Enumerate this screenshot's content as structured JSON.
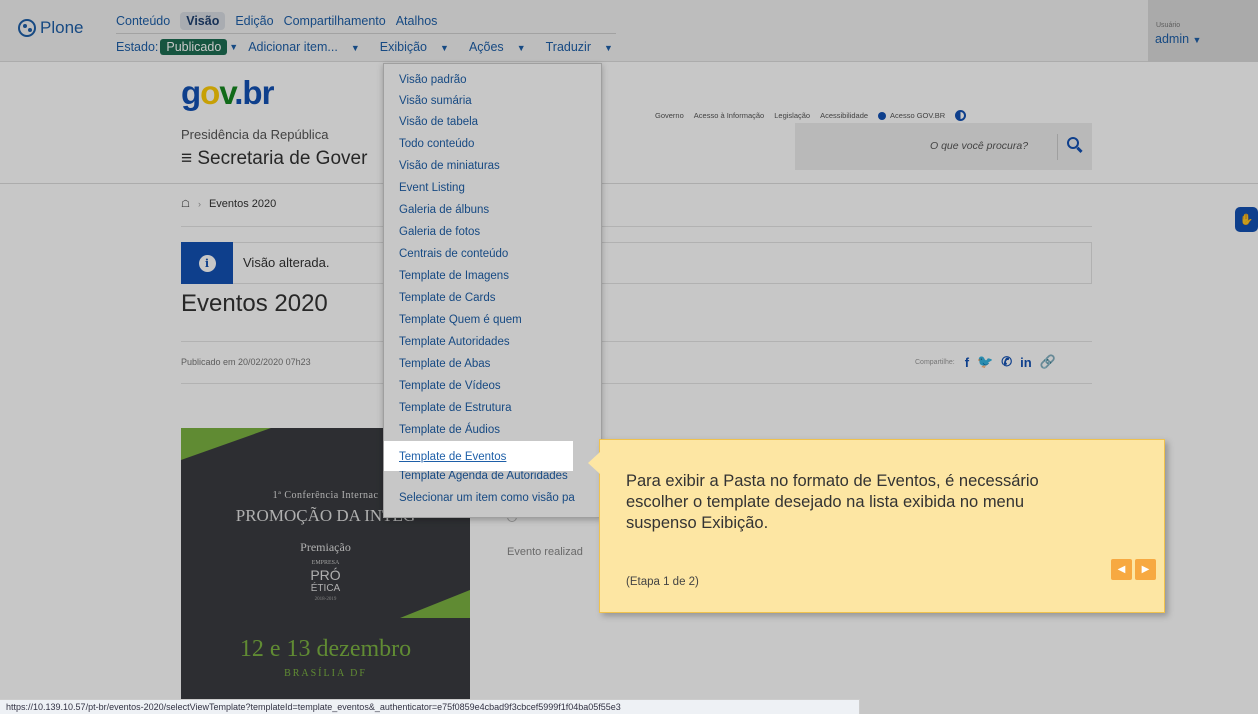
{
  "toolbar": {
    "logo": "Plone",
    "row1": [
      "Conteúdo",
      "Visão",
      "Edição",
      "Compartilhamento",
      "Atalhos"
    ],
    "active_tab": "Visão",
    "state_label": "Estado:",
    "state_value": "Publicado",
    "add_item": "Adicionar item...",
    "display": "Exibição",
    "actions": "Ações",
    "translate": "Traduzir",
    "user_label": "Usuário",
    "user_name": "admin"
  },
  "header": {
    "logo_parts": [
      "g",
      "o",
      "v",
      ".br"
    ],
    "org": "Presidência da República",
    "site": "Secretaria de Gover",
    "links": [
      "Governo",
      "Acesso à Informação",
      "Legislação",
      "Acessibilidade",
      "Acesso GOV.BR"
    ],
    "search_placeholder": "O que você procura?"
  },
  "breadcrumb": {
    "current": "Eventos 2020"
  },
  "message": {
    "text": "Visão alterada."
  },
  "page": {
    "title": "Eventos 2020",
    "byline": "Publicado em 20/02/2020 07h23",
    "share_label": "Compartilhe:",
    "share_icons": [
      "f",
      "t",
      "w",
      "in",
      "link"
    ],
    "side_text": "Evento realizad"
  },
  "event_image": {
    "line1": "1ª Conferência Internac",
    "line2": "PROMOÇÃO DA INTEG",
    "line3": "Premiação",
    "line4": "EMPRESA",
    "line5": "PRÓ",
    "line6": "ÉTICA",
    "line7": "2018-2019",
    "line8": "12 e 13 dezembro",
    "line9": "BRASÍLIA DF"
  },
  "menu": {
    "items": [
      "Visão padrão",
      "Visão sumária",
      "Visão de tabela",
      "Todo conteúdo",
      "Visão de miniaturas",
      "Event Listing",
      "Galeria de álbuns",
      "Galeria de fotos",
      "Centrais de conteúdo",
      "Template de Imagens",
      "Template de Cards",
      "Template Quem é quem",
      "Template Autoridades",
      "Template de Abas",
      "Template de Vídeos",
      "Template de Estrutura",
      "Template de Áudios",
      "Template de Eventos",
      "Template Agenda de Autoridades",
      "Selecionar um item como visão pa"
    ],
    "highlighted": "Template de Eventos"
  },
  "tour": {
    "text": "Para exibir a Pasta no formato de Eventos, é necessário escolher o template desejado na lista exibida no menu suspenso Exibição.",
    "step": "(Etapa 1 de 2)"
  },
  "status_url": "https://10.139.10.57/pt-br/eventos-2020/selectViewTemplate?templateId=template_eventos&_authenticator=e75f0859e4cbad9f3cbcef5999f1f04ba05f55e3",
  "colors": {
    "gov_blue": "#1351b4",
    "plone_blue": "#1e5fa8",
    "tooltip_bg": "#fde6a3",
    "nav_orange": "#f7a941",
    "published_green": "#1d6e52"
  }
}
